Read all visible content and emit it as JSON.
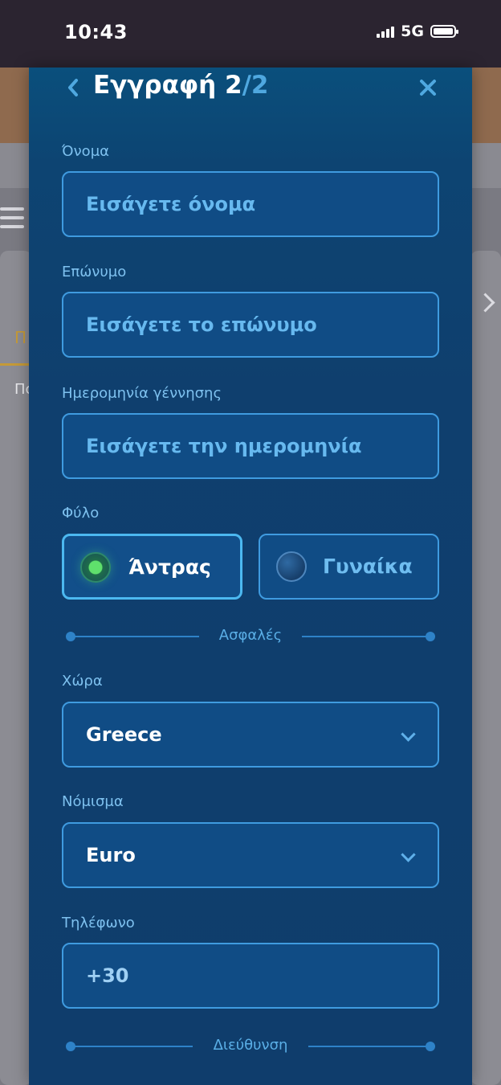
{
  "status_bar": {
    "time": "10:43",
    "network": "5G"
  },
  "background": {
    "tab_letter": "Π",
    "text_fragment": "Πο"
  },
  "modal": {
    "title_main": "Εγγραφή 2",
    "title_total": "/2"
  },
  "form": {
    "first_name": {
      "label": "Όνομα",
      "placeholder": "Εισάγετε όνομα"
    },
    "last_name": {
      "label": "Επώνυμο",
      "placeholder": "Εισάγετε το επώνυμο"
    },
    "birth_date": {
      "label": "Ημερομηνία γέννησης",
      "placeholder": "Εισάγετε την ημερομηνία"
    },
    "gender": {
      "label": "Φύλο",
      "options": [
        {
          "label": "Άντρας",
          "selected": true
        },
        {
          "label": "Γυναίκα",
          "selected": false
        }
      ]
    },
    "section_secure": "Ασφαλές",
    "country": {
      "label": "Χώρα",
      "value": "Greece"
    },
    "currency": {
      "label": "Νόμισμα",
      "value": "Euro"
    },
    "phone": {
      "label": "Τηλέφωνο",
      "value": "+30"
    },
    "section_address": "Διεύθυνση"
  },
  "colors": {
    "accent": "#3f9be0",
    "panel": "#0f3f6e",
    "selected_dot": "#5fe06c"
  }
}
